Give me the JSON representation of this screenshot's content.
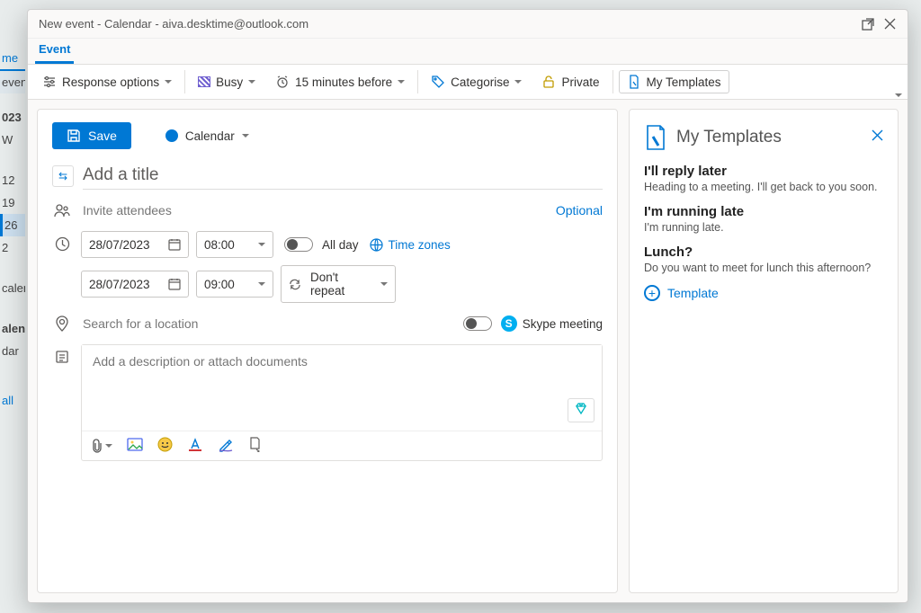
{
  "background": {
    "home_tab": "me",
    "event_word": "event",
    "year": "023",
    "w": "W",
    "d12": "12",
    "d19": "19",
    "d26": "26",
    "d2": "2",
    "calen": "calen",
    "lend": "alend",
    "dar": "dar",
    "all": "all"
  },
  "window": {
    "title": "New event - Calendar - aiva.desktime@outlook.com",
    "tab": "Event"
  },
  "ribbon": {
    "response_options": "Response options",
    "busy": "Busy",
    "reminder": "15 minutes before",
    "categorise": "Categorise",
    "private": "Private",
    "my_templates": "My Templates"
  },
  "form": {
    "save": "Save",
    "calendar_label": "Calendar",
    "title_placeholder": "Add a title",
    "attendees_placeholder": "Invite attendees",
    "optional": "Optional",
    "start_date": "28/07/2023",
    "start_time": "08:00",
    "end_date": "28/07/2023",
    "end_time": "09:00",
    "all_day": "All day",
    "time_zones": "Time zones",
    "repeat": "Don't repeat",
    "location_placeholder": "Search for a location",
    "skype": "Skype meeting",
    "description_placeholder": "Add a description or attach documents"
  },
  "panel": {
    "title": "My Templates",
    "templates": [
      {
        "name": "I'll reply later",
        "body": "Heading to a meeting. I'll get back to you soon."
      },
      {
        "name": "I'm running late",
        "body": "I'm running late."
      },
      {
        "name": "Lunch?",
        "body": "Do you want to meet for lunch this afternoon?"
      }
    ],
    "add": "Template"
  }
}
